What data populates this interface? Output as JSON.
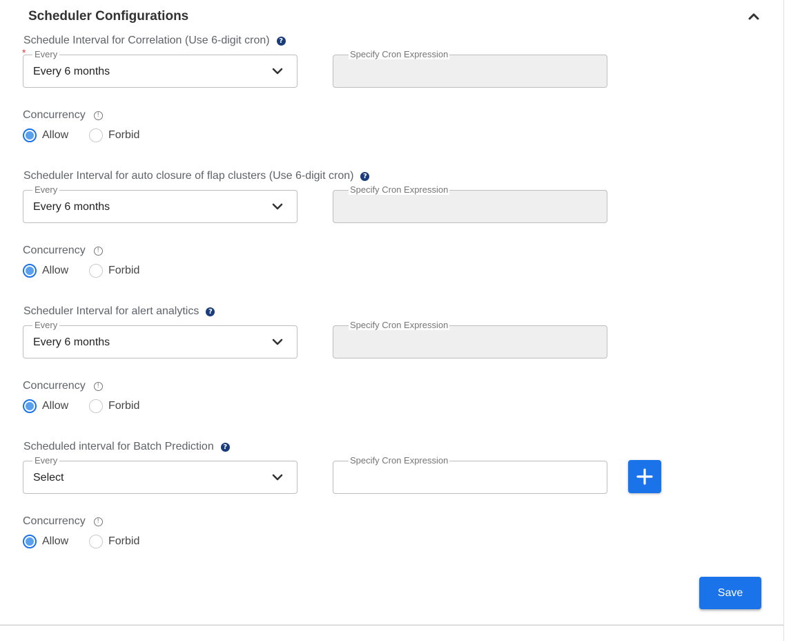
{
  "header": {
    "title": "Scheduler Configurations"
  },
  "sections": [
    {
      "label": "Schedule Interval for Correlation (Use 6-digit cron)",
      "required": true,
      "every_legend": "Every",
      "every_value": "Every 6 months",
      "cron_legend": "Specify Cron Expression",
      "cron_value": "",
      "cron_enabled": false,
      "concurrency_label": "Concurrency",
      "options": [
        "Allow",
        "Forbid"
      ],
      "selected": "Allow"
    },
    {
      "label": "Scheduler Interval for auto closure of flap clusters (Use 6-digit cron)",
      "every_legend": "Every",
      "every_value": "Every 6 months",
      "cron_legend": "Specify Cron Expression",
      "cron_value": "",
      "cron_enabled": false,
      "concurrency_label": "Concurrency",
      "options": [
        "Allow",
        "Forbid"
      ],
      "selected": "Allow"
    },
    {
      "label": "Scheduler Interval for alert analytics",
      "every_legend": "Every",
      "every_value": "Every 6 months",
      "cron_legend": "Specify Cron Expression",
      "cron_value": "",
      "cron_enabled": false,
      "concurrency_label": "Concurrency",
      "options": [
        "Allow",
        "Forbid"
      ],
      "selected": "Allow"
    },
    {
      "label": "Scheduled interval for Batch Prediction",
      "every_legend": "Every",
      "every_value": "Select",
      "cron_legend": "Specify Cron Expression",
      "cron_value": "",
      "cron_enabled": true,
      "concurrency_label": "Concurrency",
      "options": [
        "Allow",
        "Forbid"
      ],
      "selected": "Allow"
    }
  ],
  "actions": {
    "save_label": "Save"
  },
  "colors": {
    "accent": "#1a73e8",
    "help_icon": "#1a3c7c",
    "required": "#e53935",
    "disabled_field": "#efeff0"
  },
  "icons": {
    "collapse": "chevron-up-icon",
    "dropdown": "chevron-down-icon",
    "help": "question-circle-icon",
    "info": "info-circle-icon",
    "add": "plus-icon"
  }
}
